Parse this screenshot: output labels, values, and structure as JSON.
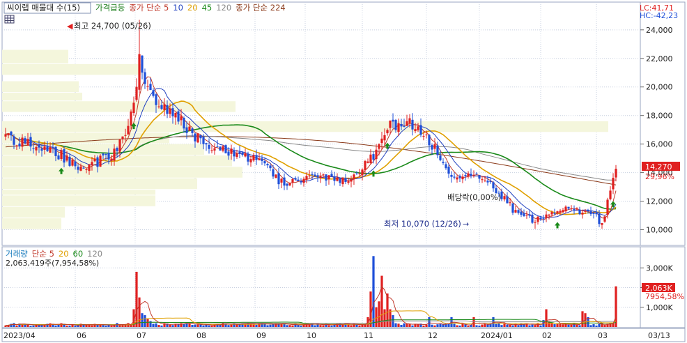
{
  "legend_main": {
    "symbol_name": "씨이랩 매물대 수(15)",
    "items": [
      {
        "text": "가격급등",
        "color": "#1f7f1f"
      },
      {
        "text": "종가 단순 5",
        "color": "#c0392b"
      },
      {
        "text": "10",
        "color": "#1f3fbf"
      },
      {
        "text": "20",
        "color": "#e0a000"
      },
      {
        "text": "45",
        "color": "#1a8a1a"
      },
      {
        "text": "120",
        "color": "#888888"
      },
      {
        "text": "종가 단순 224",
        "color": "#8b3a1a"
      }
    ],
    "lc": "LC:41,71",
    "hc": "HC:-42,23"
  },
  "legend_volume": {
    "items": [
      {
        "text": "거래량",
        "color": "#1f7fbf"
      },
      {
        "text": "단순 5",
        "color": "#c0392b"
      },
      {
        "text": "20",
        "color": "#e0a000"
      },
      {
        "text": "60",
        "color": "#1a8a1a"
      },
      {
        "text": "120",
        "color": "#888888"
      }
    ],
    "volume_info": "2,063,419주(7,954,58%)"
  },
  "annotations": {
    "high": "최고 24,700 (05/26)",
    "low": "최저 10,070 (12/26)",
    "dividend": "배당락(0,00%)"
  },
  "price_axis_labels": [
    "24,000",
    "22,000",
    "20,000",
    "18,000",
    "16,000",
    "14,000",
    "12,000",
    "10,000"
  ],
  "current_price": {
    "value": "14,270",
    "pct": "29,96%"
  },
  "volume_axis_labels": [
    "3,000K",
    "2,000K",
    "1,000K"
  ],
  "current_volume": {
    "value": "2,063K",
    "pct": "7954,58%"
  },
  "x_labels": [
    "2023/04",
    "06",
    "07",
    "08",
    "09",
    "10",
    "11",
    "12",
    "2024/01",
    "02",
    "03",
    "03/13"
  ],
  "colors": {
    "up": "#e02020",
    "down": "#1f4fd8",
    "bg": "#ffffff",
    "grid": "#c8d0e0",
    "profile": "#f4f6dc"
  },
  "chart_data": {
    "type": "candlestick",
    "title": "씨이랩 매물대 수(15)",
    "ylim": [
      9000,
      25700
    ],
    "y2lim": [
      0,
      4000
    ],
    "annotations": [
      {
        "text": "최고 24,700 (05/26)",
        "date": "2023/05/26",
        "value": 24700
      },
      {
        "text": "최저 10,070 (12/26)",
        "date": "2023/12/26",
        "value": 10070
      }
    ],
    "key_points": [
      {
        "date": "2023/04",
        "close": 16500
      },
      {
        "date": "2023/05",
        "close": 14800
      },
      {
        "date": "2023/05/26",
        "close": 22000
      },
      {
        "date": "2023/06",
        "close": 19000
      },
      {
        "date": "2023/07",
        "close": 15800
      },
      {
        "date": "2023/08",
        "close": 13500
      },
      {
        "date": "2023/09",
        "close": 17000
      },
      {
        "date": "2023/10",
        "close": 13800
      },
      {
        "date": "2023/11",
        "close": 11500
      },
      {
        "date": "2023/12",
        "close": 10800
      },
      {
        "date": "2024/01",
        "close": 12500
      },
      {
        "date": "2024/02",
        "close": 10900
      },
      {
        "date": "2024/03",
        "close": 11400
      },
      {
        "date": "2024/03/13",
        "close": 14270
      }
    ],
    "last_close": 14270,
    "last_change_pct": 29.96,
    "last_volume": 2063419
  }
}
